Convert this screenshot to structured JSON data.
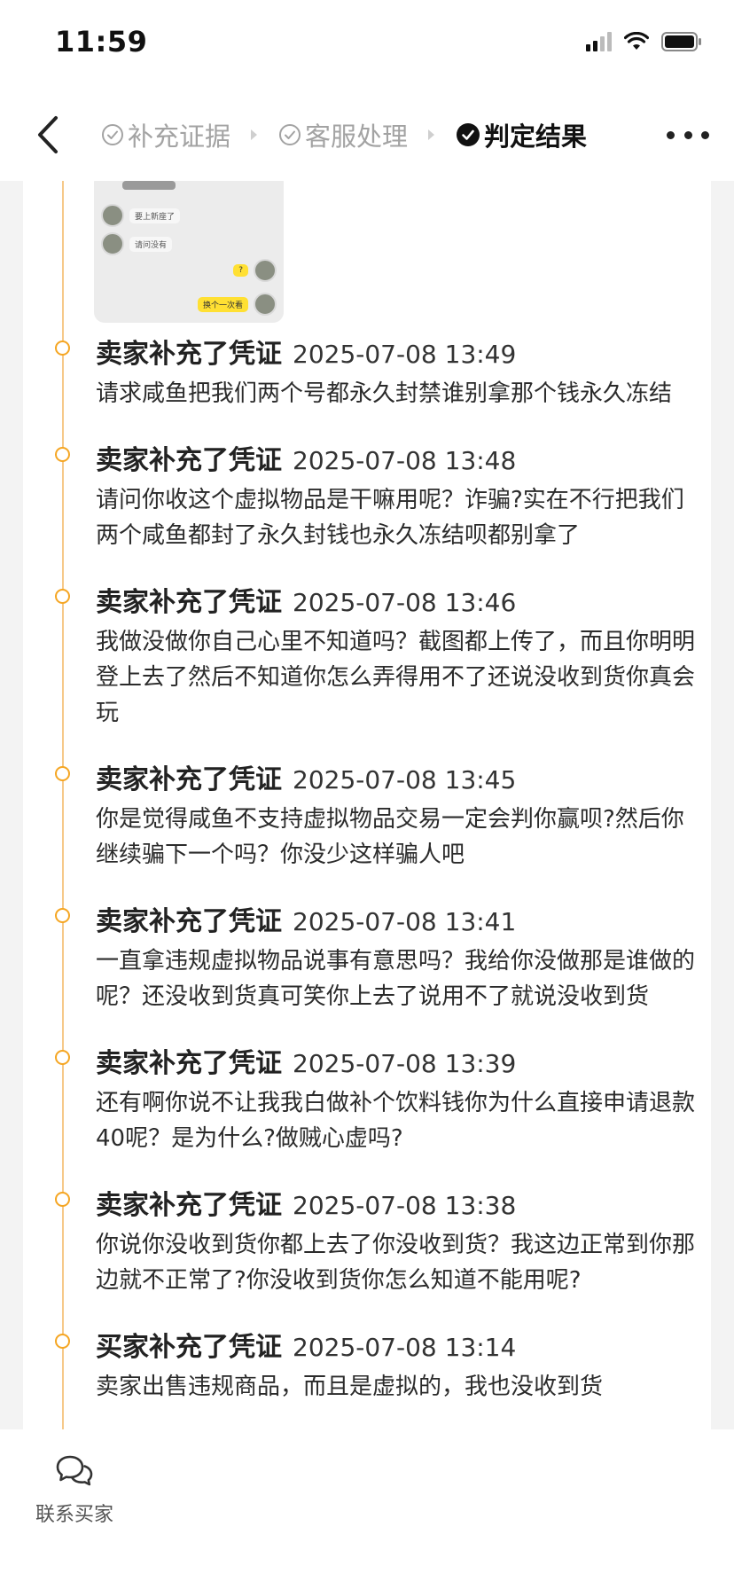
{
  "status_bar": {
    "time": "11:59"
  },
  "nav": {
    "steps": [
      {
        "label": "补充证据",
        "state": "done"
      },
      {
        "label": "客服处理",
        "state": "done"
      },
      {
        "label": "判定结果",
        "state": "active"
      }
    ]
  },
  "evidence_thumbnail": {
    "messages": [
      "要上新座了",
      "请问没有",
      "?",
      "换个一次看"
    ]
  },
  "timeline": [
    {
      "title": "卖家补充了凭证",
      "time": "2025-07-08 13:49",
      "text": "请求咸鱼把我们两个号都永久封禁谁别拿那个钱永久冻结"
    },
    {
      "title": "卖家补充了凭证",
      "time": "2025-07-08 13:48",
      "text": "请问你收这个虚拟物品是干嘛用呢？诈骗?实在不行把我们两个咸鱼都封了永久封钱也永久冻结呗都别拿了"
    },
    {
      "title": "卖家补充了凭证",
      "time": "2025-07-08 13:46",
      "text": "我做没做你自己心里不知道吗？截图都上传了，而且你明明登上去了然后不知道你怎么弄得用不了还说没收到货你真会玩"
    },
    {
      "title": "卖家补充了凭证",
      "time": "2025-07-08 13:45",
      "text": "你是觉得咸鱼不支持虚拟物品交易一定会判你赢呗?然后你继续骗下一个吗？你没少这样骗人吧"
    },
    {
      "title": "卖家补充了凭证",
      "time": "2025-07-08 13:41",
      "text": "一直拿违规虚拟物品说事有意思吗？我给你没做那是谁做的呢？还没收到货真可笑你上去了说用不了就说没收到货"
    },
    {
      "title": "卖家补充了凭证",
      "time": "2025-07-08 13:39",
      "text": "还有啊你说不让我我白做补个饮料钱你为什么直接申请退款40呢？是为什么?做贼心虚吗?"
    },
    {
      "title": "卖家补充了凭证",
      "time": "2025-07-08 13:38",
      "text": "你说你没收到货你都上去了你没收到货？我这边正常到你那边就不正常了?你没收到货你怎么知道不能用呢?"
    },
    {
      "title": "买家补充了凭证",
      "time": "2025-07-08 13:14",
      "text": "卖家出售违规商品，而且是虚拟的，我也没收到货"
    }
  ],
  "bottom": {
    "contact_label": "联系买家"
  },
  "colors": {
    "accent": "#f5a623",
    "timeline_line": "#f6c98a"
  }
}
